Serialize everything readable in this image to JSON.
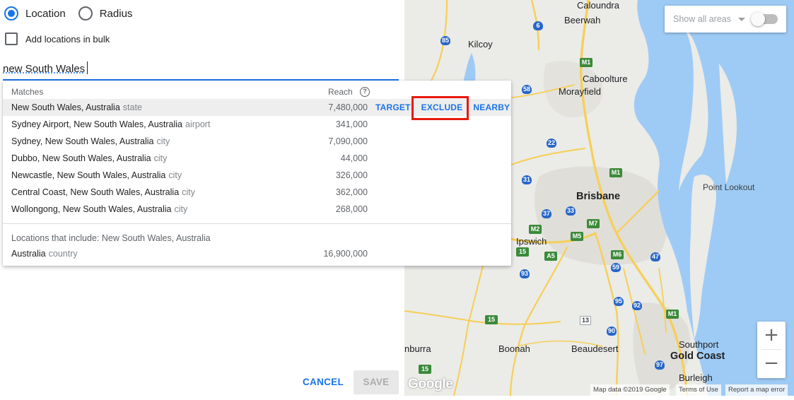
{
  "targeting": {
    "radio_location": "Location",
    "radio_radius": "Radius",
    "bulk_label": "Add locations in bulk",
    "search_value": "new South Wales"
  },
  "dropdown": {
    "col_matches": "Matches",
    "col_reach": "Reach",
    "help_glyph": "?",
    "actions": {
      "target": "TARGET",
      "exclude": "EXCLUDE",
      "nearby": "NEARBY"
    },
    "matches": [
      {
        "name": "New South Wales, Australia",
        "type": "state",
        "reach": "7,480,000"
      },
      {
        "name": "Sydney Airport, New South Wales, Australia",
        "type": "airport",
        "reach": "341,000"
      },
      {
        "name": "Sydney, New South Wales, Australia",
        "type": "city",
        "reach": "7,090,000"
      },
      {
        "name": "Dubbo, New South Wales, Australia",
        "type": "city",
        "reach": "44,000"
      },
      {
        "name": "Newcastle, New South Wales, Australia",
        "type": "city",
        "reach": "326,000"
      },
      {
        "name": "Central Coast, New South Wales, Australia",
        "type": "city",
        "reach": "362,000"
      },
      {
        "name": "Wollongong, New South Wales, Australia",
        "type": "city",
        "reach": "268,000"
      }
    ],
    "includes_heading": "Locations that include: New South Wales, Australia",
    "includes": [
      {
        "name": "Australia",
        "type": "country",
        "reach": "16,900,000"
      }
    ]
  },
  "footer": {
    "cancel": "CANCEL",
    "save": "SAVE"
  },
  "map": {
    "area_select": "Show all areas",
    "zoom_in": "+",
    "zoom_out": "−",
    "logo": "Google",
    "attribution": {
      "data": "Map data ©2019 Google",
      "terms": "Terms of Use",
      "report": "Report a map error"
    },
    "places": {
      "caloundra": "Caloundra",
      "beerwah": "Beerwah",
      "kilcoy": "Kilcoy",
      "caboolture": "Caboolture",
      "morayfield": "Morayfield",
      "brisbane": "Brisbane",
      "point_lookout": "Point Lookout",
      "ipswich": "Ipswich",
      "boonah": "Boonah",
      "beaudesert": "Beaudesert",
      "southport": "Southport",
      "gold_coast": "Gold Coast",
      "burleigh": "Burleigh",
      "nburra": "nburra"
    },
    "shields": {
      "r6": "6",
      "r85": "85",
      "rM1a": "M1",
      "r58": "58",
      "r22": "22",
      "rM1b": "M1",
      "r31": "31",
      "r37": "37",
      "r33": "33",
      "rM7": "M7",
      "rM2": "M2",
      "rM5": "M5",
      "r15a": "15",
      "rA5": "A5",
      "rM6": "M6",
      "r47": "47",
      "r59": "59",
      "r93": "93",
      "r95": "95",
      "r92": "92",
      "r15b": "15",
      "r13": "13",
      "r90": "90",
      "rM1c": "M1",
      "r97": "97",
      "r15c": "15"
    },
    "colors": {
      "water": "#9ecbf5",
      "land": "#ebebe8",
      "road": "#f6cf55",
      "urban": "#e0ded8"
    }
  }
}
